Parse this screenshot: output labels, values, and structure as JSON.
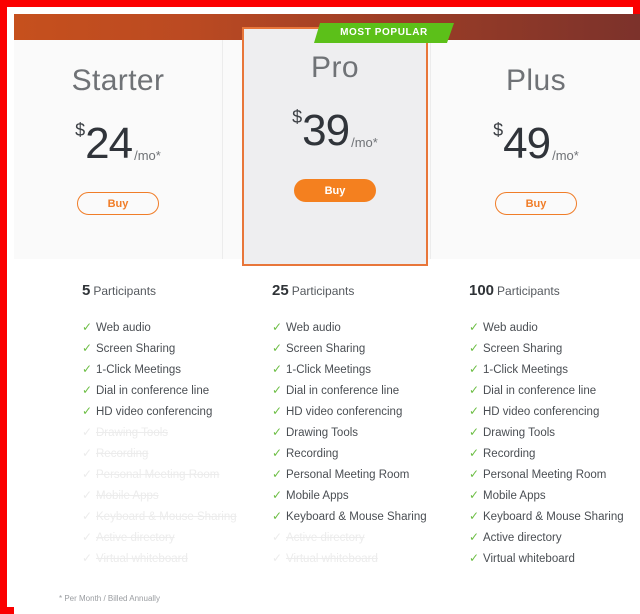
{
  "ribbon": {
    "label": "MOST POPULAR"
  },
  "colors": {
    "red_frame": "#fb0000",
    "header_left": "#c6501d",
    "header_right": "#7c322b",
    "accent_orange": "#f4801f",
    "highlight_border": "#e8763a",
    "ribbon_green": "#5cc019",
    "check_green": "#6dbe45"
  },
  "plans": [
    {
      "name": "Starter",
      "currency": "$",
      "amount": "24",
      "period": "/mo*",
      "buy_label": "Buy",
      "buy_style": "outline",
      "highlighted": false,
      "participants_count": "5",
      "participants_label": "Participants",
      "features": [
        {
          "label": "Web audio",
          "included": true
        },
        {
          "label": "Screen Sharing",
          "included": true
        },
        {
          "label": "1-Click Meetings",
          "included": true
        },
        {
          "label": "Dial in conference line",
          "included": true
        },
        {
          "label": "HD video conferencing",
          "included": true
        },
        {
          "label": "Drawing Tools",
          "included": false
        },
        {
          "label": "Recording",
          "included": false
        },
        {
          "label": "Personal Meeting Room",
          "included": false
        },
        {
          "label": "Mobile Apps",
          "included": false
        },
        {
          "label": "Keyboard & Mouse Sharing",
          "included": false
        },
        {
          "label": "Active directory",
          "included": false
        },
        {
          "label": "Virtual whiteboard",
          "included": false
        }
      ]
    },
    {
      "name": "Pro",
      "currency": "$",
      "amount": "39",
      "period": "/mo*",
      "buy_label": "Buy",
      "buy_style": "solid",
      "highlighted": true,
      "participants_count": "25",
      "participants_label": "Participants",
      "features": [
        {
          "label": "Web audio",
          "included": true
        },
        {
          "label": "Screen Sharing",
          "included": true
        },
        {
          "label": "1-Click Meetings",
          "included": true
        },
        {
          "label": "Dial in conference line",
          "included": true
        },
        {
          "label": "HD video conferencing",
          "included": true
        },
        {
          "label": "Drawing Tools",
          "included": true
        },
        {
          "label": "Recording",
          "included": true
        },
        {
          "label": "Personal Meeting Room",
          "included": true
        },
        {
          "label": "Mobile Apps",
          "included": true
        },
        {
          "label": "Keyboard & Mouse Sharing",
          "included": true
        },
        {
          "label": "Active directory",
          "included": false
        },
        {
          "label": "Virtual whiteboard",
          "included": false
        }
      ]
    },
    {
      "name": "Plus",
      "currency": "$",
      "amount": "49",
      "period": "/mo*",
      "buy_label": "Buy",
      "buy_style": "outline",
      "highlighted": false,
      "participants_count": "100",
      "participants_label": "Participants",
      "features": [
        {
          "label": "Web audio",
          "included": true
        },
        {
          "label": "Screen Sharing",
          "included": true
        },
        {
          "label": "1-Click Meetings",
          "included": true
        },
        {
          "label": "Dial in conference line",
          "included": true
        },
        {
          "label": "HD video conferencing",
          "included": true
        },
        {
          "label": "Drawing Tools",
          "included": true
        },
        {
          "label": "Recording",
          "included": true
        },
        {
          "label": "Personal Meeting Room",
          "included": true
        },
        {
          "label": "Mobile Apps",
          "included": true
        },
        {
          "label": "Keyboard & Mouse Sharing",
          "included": true
        },
        {
          "label": "Active directory",
          "included": true
        },
        {
          "label": "Virtual whiteboard",
          "included": true
        }
      ]
    }
  ],
  "icons": {
    "check": "✓"
  },
  "footnote": "* Per Month / Billed Annually"
}
